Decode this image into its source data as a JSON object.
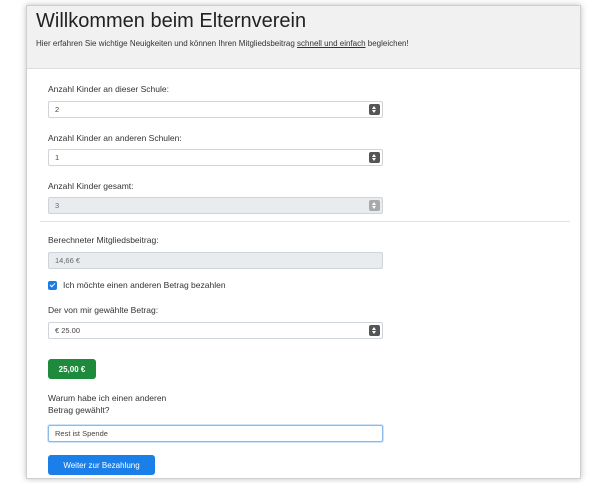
{
  "header": {
    "title": "Willkommen beim Elternverein",
    "intro_before": "Hier erfahren Sie wichtige Neuigkeiten und können Ihren Mitgliedsbeitrag ",
    "intro_link": "schnell und einfach",
    "intro_after": " begleichen!"
  },
  "form": {
    "kids_school_label": "Anzahl Kinder an dieser Schule:",
    "kids_school_value": "2",
    "kids_other_label": "Anzahl Kinder an anderen Schulen:",
    "kids_other_value": "1",
    "kids_total_label": "Anzahl Kinder gesamt:",
    "kids_total_value": "3",
    "fee_label": "Berechneter Mitgliedsbeitrag:",
    "fee_value": "14,66 €",
    "other_amount_checkbox": "Ich möchte einen anderen Betrag bezahlen",
    "chosen_amount_label": "Der von mir gewählte Betrag:",
    "chosen_amount_value": "€ 25.00",
    "amount_badge": "25,00 €",
    "reason_label_line1": "Warum habe ich einen anderen",
    "reason_label_line2": "Betrag gewählt?",
    "reason_value": "Rest ist Spende",
    "submit_button": "Weiter zur Bezahlung"
  },
  "colors": {
    "success": "#1e8a3b",
    "primary": "#1a7fe8",
    "checkbox": "#1e7be0"
  },
  "icons": [
    "spinner-arrows-icon",
    "checkmark-icon"
  ]
}
